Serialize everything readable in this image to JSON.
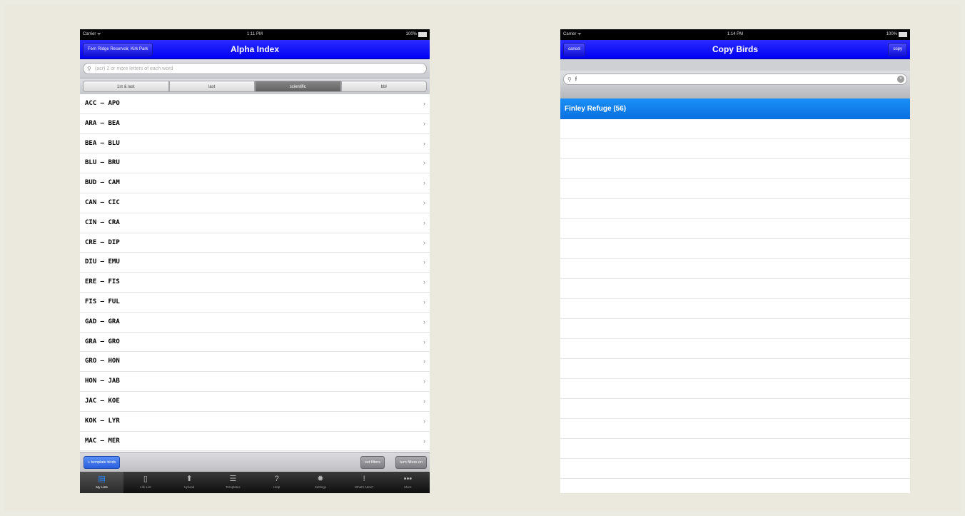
{
  "left": {
    "status": {
      "carrier": "Carrier ᯤ",
      "time": "1:11 PM",
      "battery": "100%"
    },
    "nav": {
      "back_label": "Fern Ridge Reservoir, Kirk Park",
      "title": "Alpha Index"
    },
    "search": {
      "placeholder": "(acr) 2 or more letters of each word"
    },
    "segments": [
      "1st & last",
      "last",
      "scientific",
      "bbl"
    ],
    "rows": [
      "ACC – APO",
      "ARA – BEA",
      "BEA – BLU",
      "BLU – BRU",
      "BUD – CAM",
      "CAN – CIC",
      "CIN – CRA",
      "CRE – DIP",
      "DIU – EMU",
      "ERE – FIS",
      "FIS – FUL",
      "GAD – GRA",
      "GRA – GRO",
      "GRO – HON",
      "HON – JAB",
      "JAC – KOE",
      "KOK – LYR",
      "MAC – MER"
    ],
    "chevron": "›",
    "bottom": {
      "template_label": "+ template birds",
      "set_filters": "set filters",
      "turn_filters_on": "turn filters on"
    },
    "tabs": [
      {
        "label": "My Lists",
        "icon": "▤"
      },
      {
        "label": "Life List",
        "icon": "▯"
      },
      {
        "label": "Upload",
        "icon": "⬆"
      },
      {
        "label": "Templates",
        "icon": "☰"
      },
      {
        "label": "Help",
        "icon": "?"
      },
      {
        "label": "Settings",
        "icon": "✹"
      },
      {
        "label": "What's New?",
        "icon": "!"
      },
      {
        "label": "More",
        "icon": "•••"
      }
    ]
  },
  "right": {
    "status": {
      "carrier": "Carrier ᯤ",
      "time": "1:14 PM",
      "battery": "100%"
    },
    "nav": {
      "cancel_label": "cancel",
      "title": "Copy Birds",
      "copy_label": "copy"
    },
    "search": {
      "value": "f",
      "clear": "×"
    },
    "result": "Finley Refuge (56)"
  }
}
